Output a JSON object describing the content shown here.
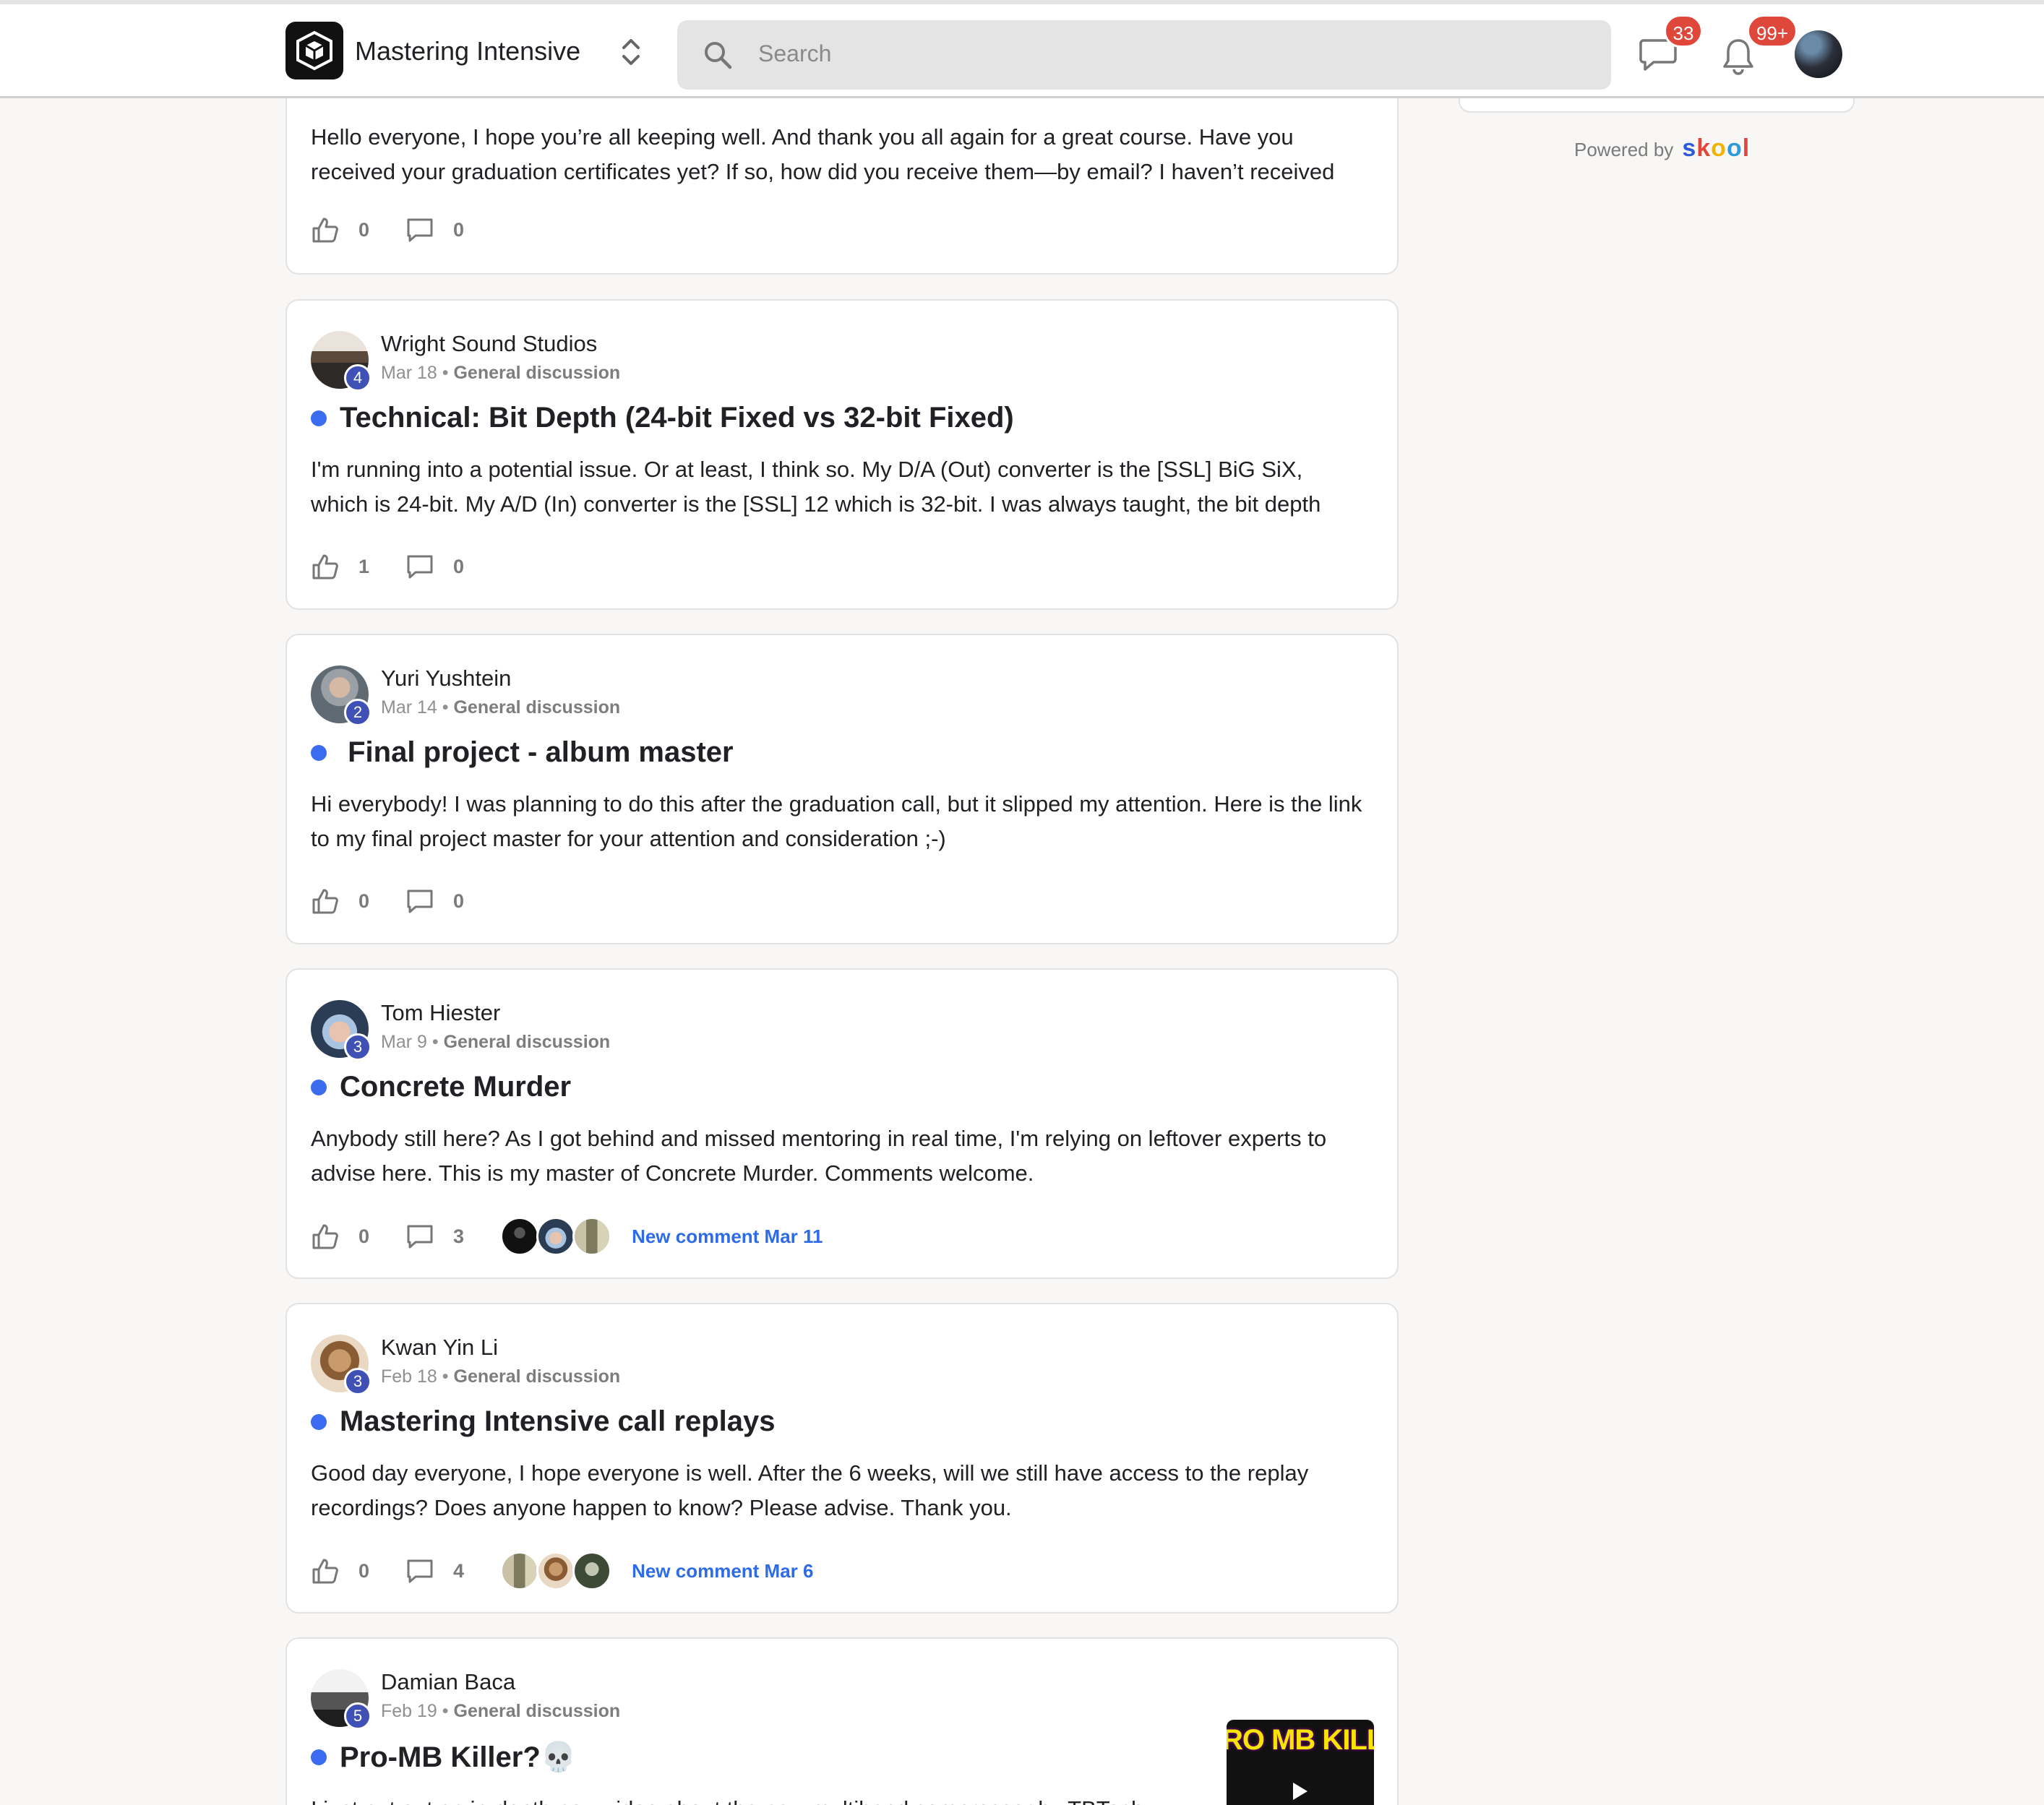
{
  "header": {
    "group_name": "Mastering Intensive",
    "search_placeholder": "Search",
    "chat_badge": "33",
    "notifications_badge": "99+"
  },
  "sidebar": {
    "powered_by": "Powered by",
    "brand": "skool"
  },
  "posts": [
    {
      "author": "",
      "date": "",
      "category": "",
      "title": "",
      "excerpt": "Hello everyone, I hope you’re all keeping well. And thank you all again for a great course. Have you received your graduation certificates yet? If so, how did you receive them—by email? I haven’t received",
      "likes": "0",
      "comments": "0"
    },
    {
      "author": "Wright Sound Studios",
      "level": "4",
      "date": "Mar 18",
      "category": "General discussion",
      "title": "Technical: Bit Depth (24-bit Fixed vs 32-bit Fixed)",
      "excerpt": "I'm running into a potential issue. Or at least, I think so. My D/A (Out) converter is the [SSL] BiG SiX, which is 24-bit. My A/D (In) converter is the [SSL] 12 which is 32-bit. I was always taught, the bit depth",
      "likes": "1",
      "comments": "0"
    },
    {
      "author": "Yuri Yushtein",
      "level": "2",
      "date": "Mar 14",
      "category": "General discussion",
      "title": " Final project - album master",
      "excerpt": "Hi everybody! I was planning to do this after the graduation call, but it slipped my attention. Here is the link to my final project master for your attention and consideration ;-)",
      "likes": "0",
      "comments": "0"
    },
    {
      "author": "Tom Hiester",
      "level": "3",
      "date": "Mar 9",
      "category": "General discussion",
      "title": "Concrete Murder",
      "excerpt": "Anybody still here? As I got behind and missed mentoring in real time, I'm relying on leftover experts to advise here. This is my master of Concrete Murder. Comments welcome.",
      "likes": "0",
      "comments": "3",
      "new_comment": "New comment Mar 11"
    },
    {
      "author": "Kwan Yin Li",
      "level": "3",
      "date": "Feb 18",
      "category": "General discussion",
      "title": "Mastering Intensive call replays",
      "excerpt": "Good day everyone, I hope everyone is well. After the 6 weeks, will we still have access to the replay recordings? Does anyone happen to know? Please advise. Thank you.",
      "likes": "0",
      "comments": "4",
      "new_comment": "New comment Mar 6"
    },
    {
      "author": "Damian Baca",
      "level": "5",
      "date": "Feb 19",
      "category": "General discussion",
      "title": "Pro-MB Killer?💀",
      "excerpt": "I just put out an in-depth new video about the new multiband compressor by TBTech",
      "thumbnail_text": "RO MB KILLER"
    }
  ],
  "colors": {
    "accent_blue": "#3b6cf0",
    "level_badge": "#3f51b5",
    "badge_red": "#e0473b",
    "link_blue": "#2e6be6"
  }
}
